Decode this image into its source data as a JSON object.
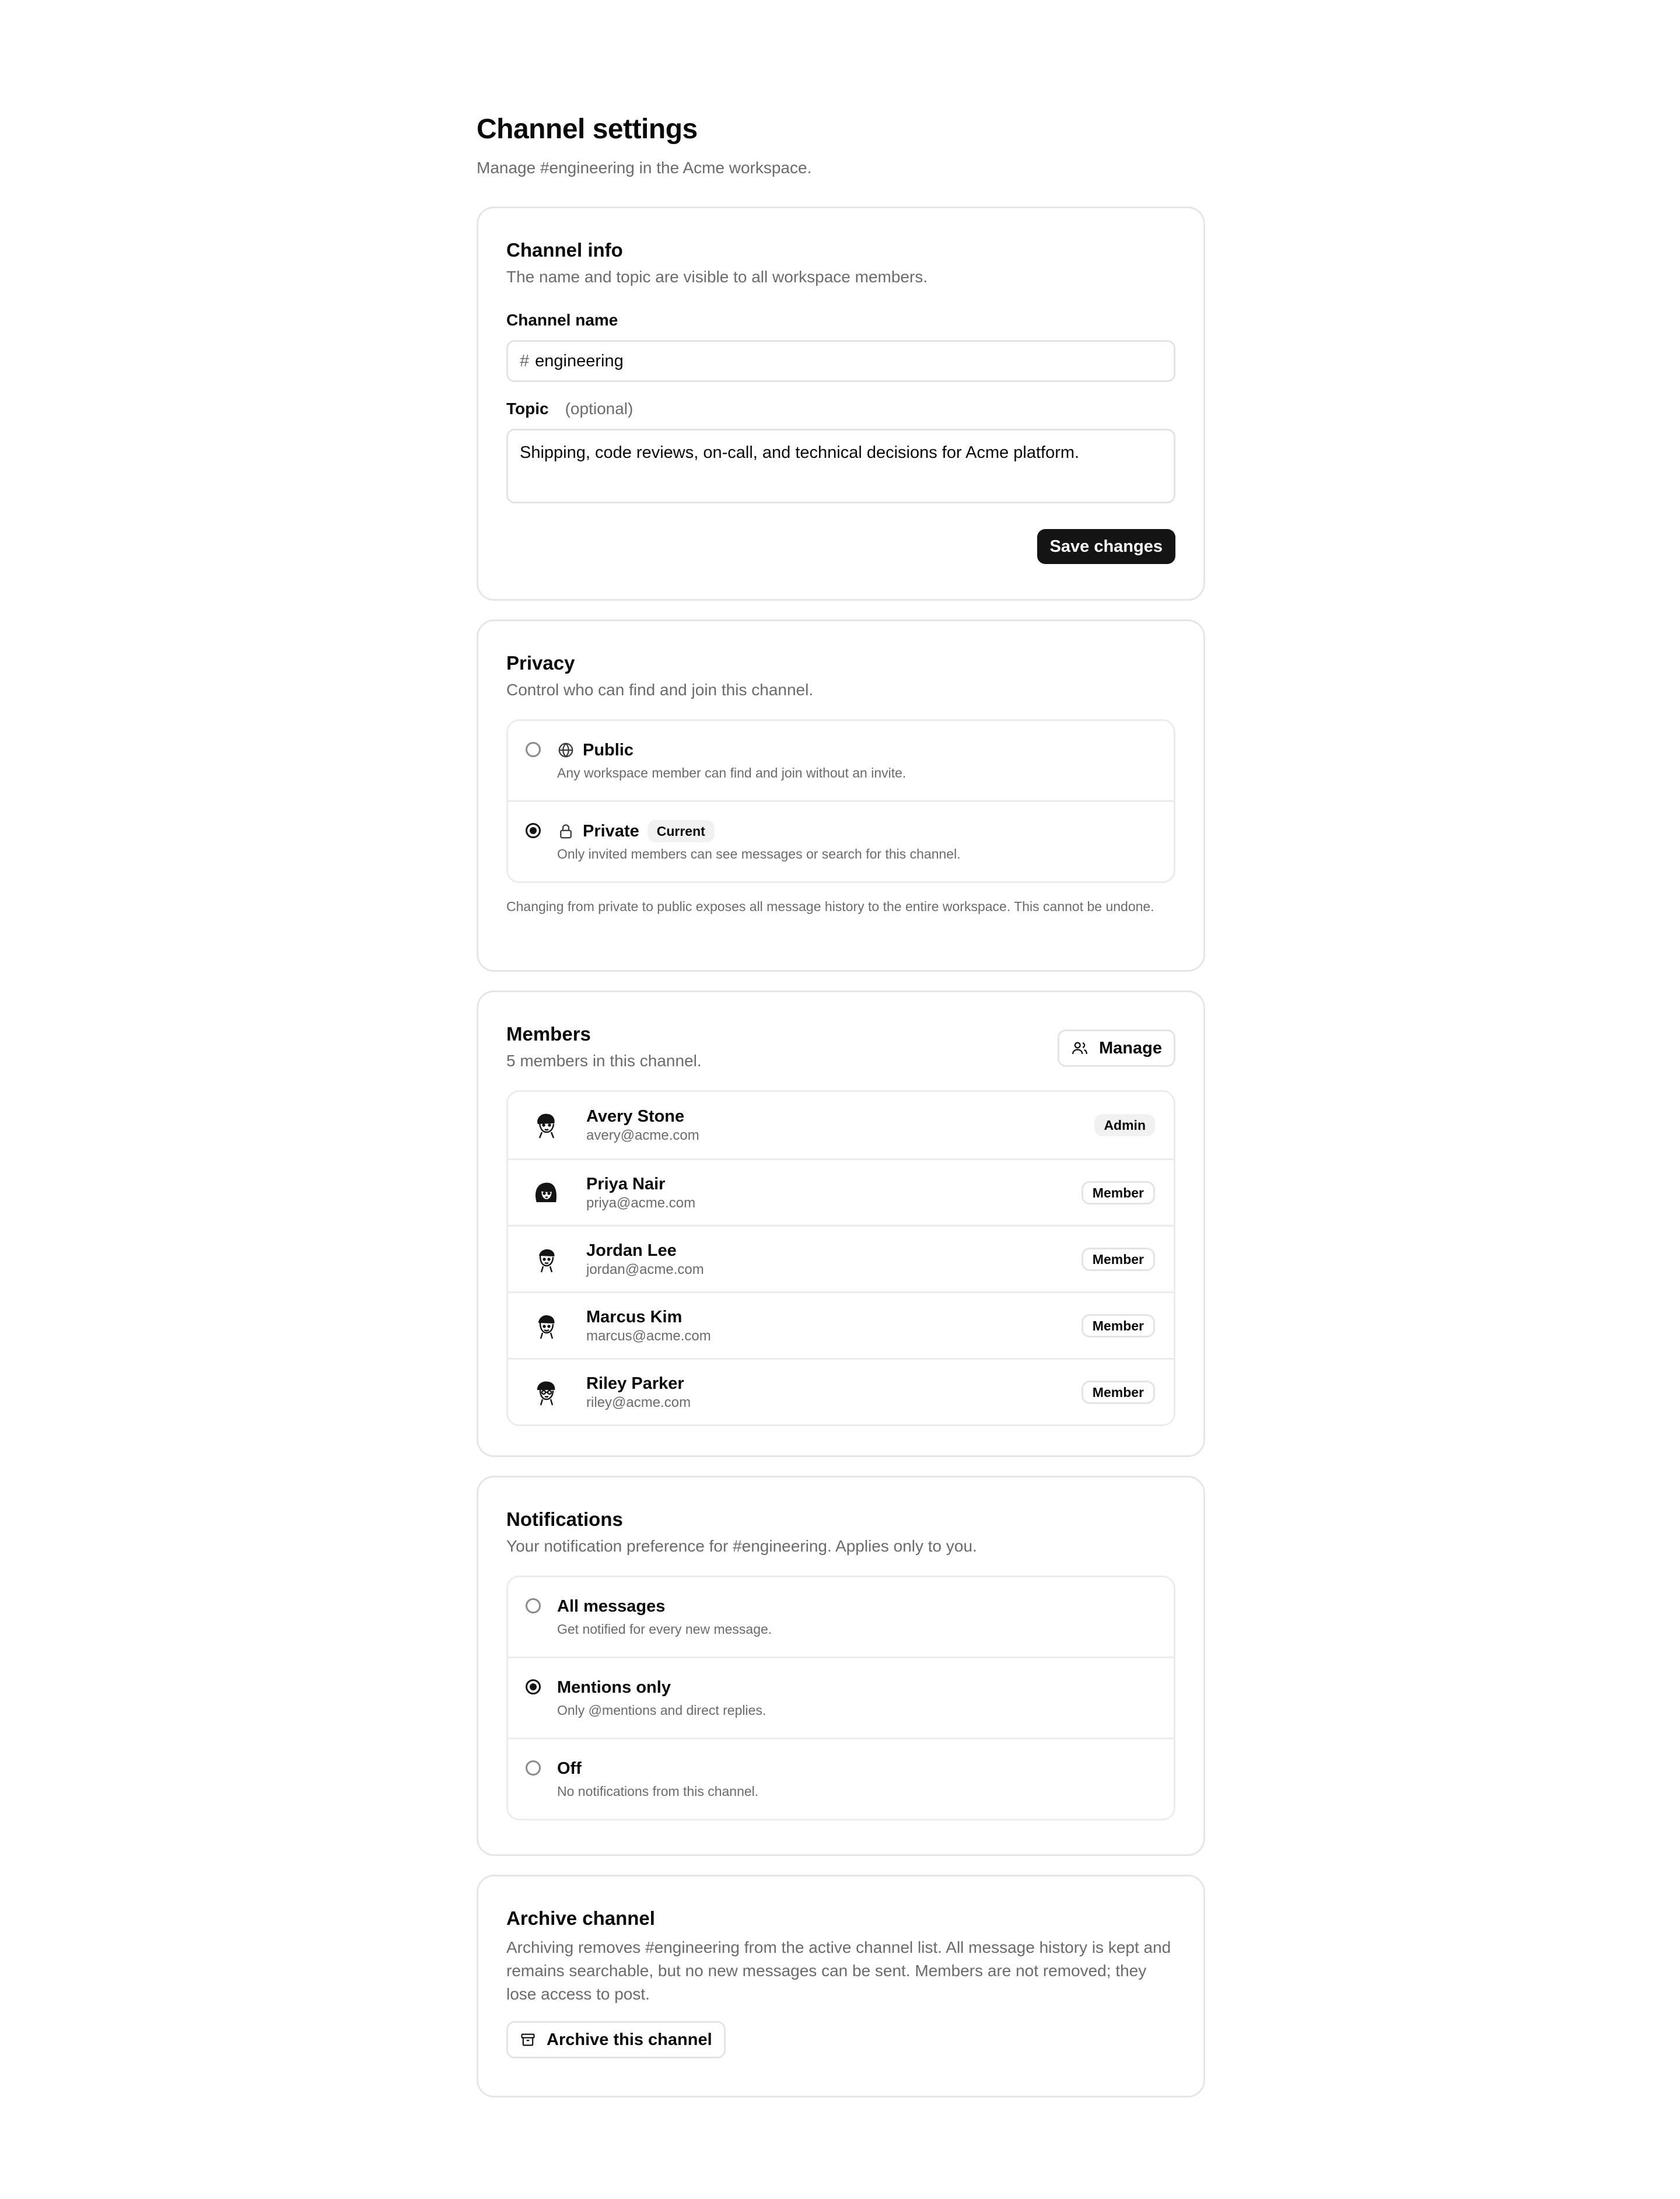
{
  "page": {
    "title": "Channel settings",
    "subtitle": "Manage #engineering in the Acme workspace."
  },
  "channel_info": {
    "title": "Channel info",
    "subtitle": "The name and topic are visible to all workspace members.",
    "name_label": "Channel name",
    "name_prefix": "#",
    "name_value": "engineering",
    "topic_label": "Topic",
    "topic_optional": "(optional)",
    "topic_value": "Shipping, code reviews, on-call, and technical decisions for Acme platform.",
    "save_label": "Save changes"
  },
  "privacy": {
    "title": "Privacy",
    "subtitle": "Control who can find and join this channel.",
    "options": [
      {
        "label": "Public",
        "icon": "globe-icon",
        "desc": "Any workspace member can find and join without an invite.",
        "selected": false
      },
      {
        "label": "Private",
        "icon": "lock-icon",
        "badge": "Current",
        "desc": "Only invited members can see messages or search for this channel.",
        "selected": true
      }
    ],
    "note": "Changing from private to public exposes all message history to the entire workspace. This cannot be undone."
  },
  "members": {
    "title": "Members",
    "subtitle": "5 members in this channel.",
    "manage_label": "Manage",
    "list": [
      {
        "name": "Avery Stone",
        "email": "avery@acme.com",
        "role": "Admin"
      },
      {
        "name": "Priya Nair",
        "email": "priya@acme.com",
        "role": "Member"
      },
      {
        "name": "Jordan Lee",
        "email": "jordan@acme.com",
        "role": "Member"
      },
      {
        "name": "Marcus Kim",
        "email": "marcus@acme.com",
        "role": "Member"
      },
      {
        "name": "Riley Parker",
        "email": "riley@acme.com",
        "role": "Member"
      }
    ]
  },
  "notifications": {
    "title": "Notifications",
    "subtitle": "Your notification preference for #engineering. Applies only to you.",
    "options": [
      {
        "label": "All messages",
        "desc": "Get notified for every new message.",
        "selected": false
      },
      {
        "label": "Mentions only",
        "desc": "Only @mentions and direct replies.",
        "selected": true
      },
      {
        "label": "Off",
        "desc": "No notifications from this channel.",
        "selected": false
      }
    ]
  },
  "archive": {
    "title": "Archive channel",
    "desc": "Archiving removes #engineering from the active channel list. All message history is kept and remains searchable, but no new messages can be sent. Members are not removed; they lose access to post.",
    "button_label": "Archive this channel"
  }
}
